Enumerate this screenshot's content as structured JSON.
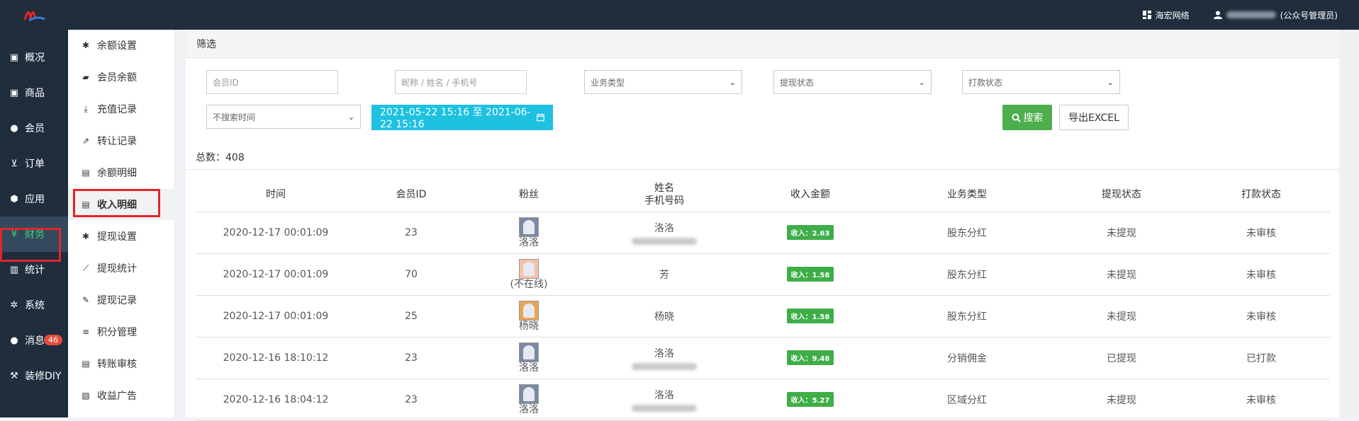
{
  "topbar": {
    "org_label": "海宏网络",
    "user_label": "(公众号管理员)"
  },
  "leftnav": [
    {
      "label": "概况",
      "icon": "dashboard-icon"
    },
    {
      "label": "商品",
      "icon": "box-icon"
    },
    {
      "label": "会员",
      "icon": "users-icon"
    },
    {
      "label": "订单",
      "icon": "cart-icon"
    },
    {
      "label": "应用",
      "icon": "cubes-icon"
    },
    {
      "label": "财务",
      "icon": "yen-icon",
      "active": true
    },
    {
      "label": "统计",
      "icon": "bar-chart-icon"
    },
    {
      "label": "系统",
      "icon": "cogs-icon"
    },
    {
      "label": "消息",
      "icon": "comment-icon",
      "badge": "46"
    },
    {
      "label": "装修DIY",
      "icon": "hammer-icon"
    }
  ],
  "subnav": [
    {
      "label": "余额设置",
      "icon": "gear-icon"
    },
    {
      "label": "会员余额",
      "icon": "book-icon"
    },
    {
      "label": "充值记录",
      "icon": "download-icon"
    },
    {
      "label": "转让记录",
      "icon": "external-link-icon"
    },
    {
      "label": "余额明细",
      "icon": "file-icon"
    },
    {
      "label": "收入明细",
      "icon": "file-icon",
      "active": true
    },
    {
      "label": "提现设置",
      "icon": "gear-icon"
    },
    {
      "label": "提现统计",
      "icon": "line-chart-icon"
    },
    {
      "label": "提现记录",
      "icon": "pencil-icon"
    },
    {
      "label": "积分管理",
      "icon": "database-icon"
    },
    {
      "label": "转账审核",
      "icon": "file-icon"
    },
    {
      "label": "收益广告",
      "icon": "image-icon"
    }
  ],
  "filter": {
    "title": "筛选",
    "member_id_placeholder": "会员ID",
    "name_placeholder": "昵称 / 姓名 / 手机号",
    "biz_type": "业务类型",
    "withdraw_status": "提现状态",
    "pay_status": "打款状态",
    "time_mode": "不搜索时间",
    "date_range": "2021-05-22 15:16 至 2021-06-22 15:16",
    "search_label": "搜索",
    "export_label": "导出EXCEL"
  },
  "total_label": "总数：408",
  "table": {
    "headers": {
      "time": "时间",
      "member_id": "会员ID",
      "fan": "粉丝",
      "name_line1": "姓名",
      "name_line2": "手机号码",
      "amount": "收入金额",
      "biz": "业务类型",
      "withdraw": "提现状态",
      "pay": "打款状态"
    },
    "rows": [
      {
        "time": "2020-12-17 00:01:09",
        "member_id": "23",
        "fan": "洛洛",
        "name": "洛洛",
        "amount": "收入：2.63",
        "biz": "股东分红",
        "withdraw": "未提现",
        "pay": "未审核"
      },
      {
        "time": "2020-12-17 00:01:09",
        "member_id": "70",
        "fan": "(不在线)",
        "name": "芳",
        "amount": "收入：1.58",
        "biz": "股东分红",
        "withdraw": "未提现",
        "pay": "未审核"
      },
      {
        "time": "2020-12-17 00:01:09",
        "member_id": "25",
        "fan": "杨晓",
        "name": "杨晓",
        "amount": "收入：1.58",
        "biz": "股东分红",
        "withdraw": "未提现",
        "pay": "未审核"
      },
      {
        "time": "2020-12-16 18:10:12",
        "member_id": "23",
        "fan": "洛洛",
        "name": "洛洛",
        "amount": "收入：9.48",
        "biz": "分销佣金",
        "withdraw": "已提现",
        "pay": "已打款"
      },
      {
        "time": "2020-12-16 18:04:12",
        "member_id": "23",
        "fan": "洛洛",
        "name": "洛洛",
        "amount": "收入：5.27",
        "biz": "区域分红",
        "withdraw": "未提现",
        "pay": "未审核"
      }
    ]
  }
}
